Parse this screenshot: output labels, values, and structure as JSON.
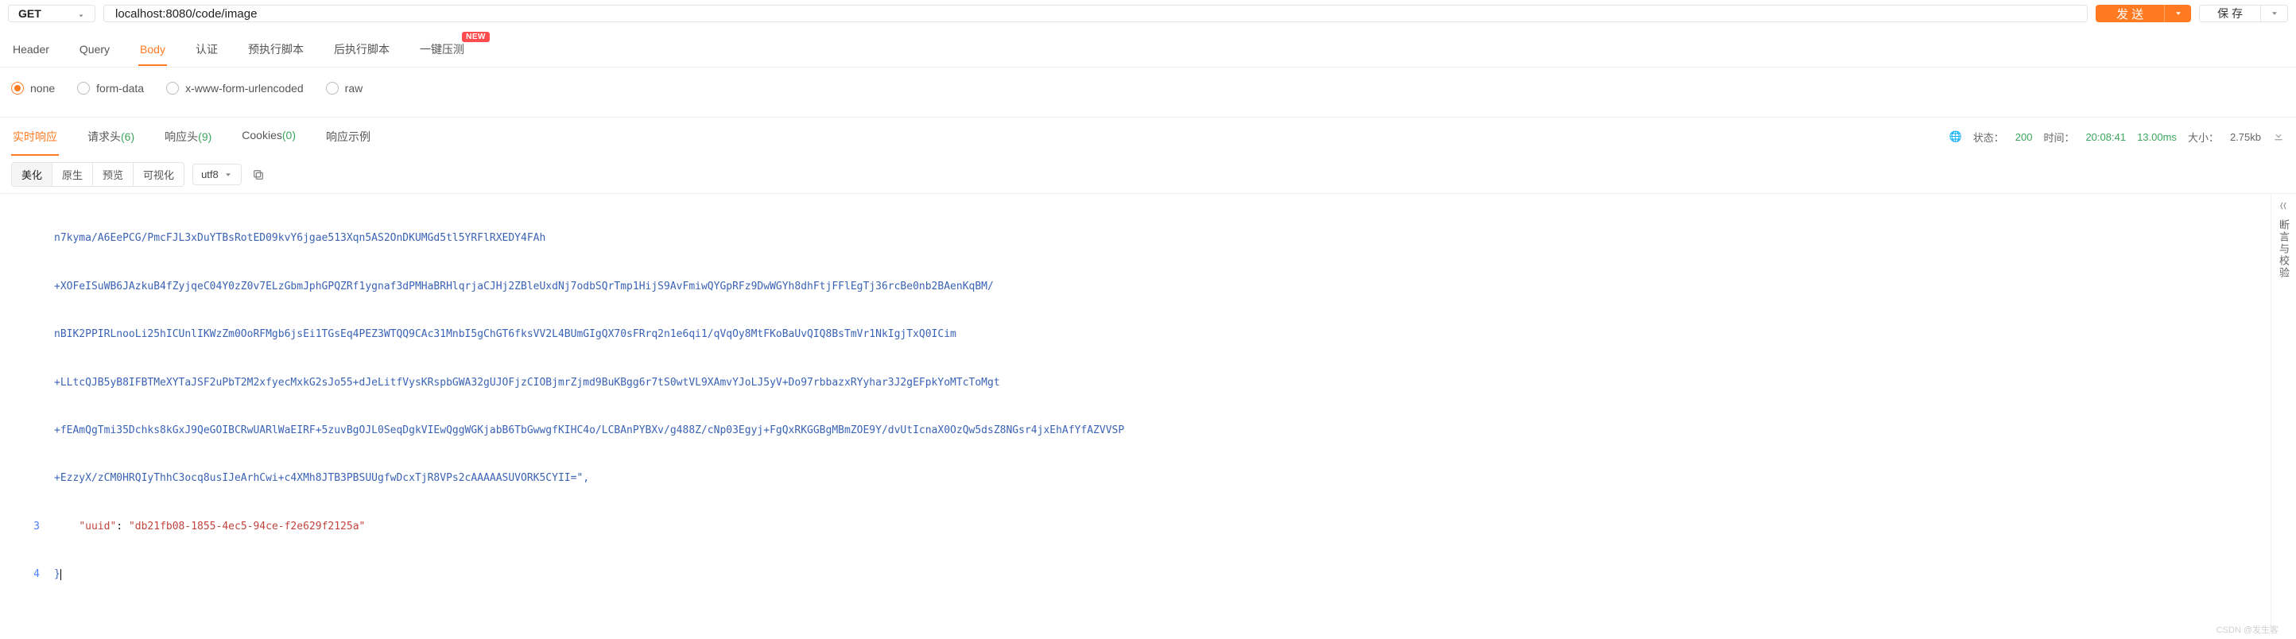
{
  "request": {
    "method": "GET",
    "url": "localhost:8080/code/image",
    "send_label": "发 送",
    "save_label": "保 存"
  },
  "request_tabs": {
    "items": [
      {
        "label": "Header"
      },
      {
        "label": "Query"
      },
      {
        "label": "Body",
        "active": true
      },
      {
        "label": "认证"
      },
      {
        "label": "预执行脚本"
      },
      {
        "label": "后执行脚本"
      },
      {
        "label": "一键压测",
        "badge": "NEW"
      }
    ]
  },
  "body_types": {
    "options": [
      {
        "label": "none",
        "checked": true
      },
      {
        "label": "form-data"
      },
      {
        "label": "x-www-form-urlencoded"
      },
      {
        "label": "raw"
      }
    ]
  },
  "response_tabs": {
    "items": [
      {
        "label": "实时响应",
        "active": true
      },
      {
        "label": "请求头",
        "count": 6
      },
      {
        "label": "响应头",
        "count": 9
      },
      {
        "label": "Cookies",
        "count": 0
      },
      {
        "label": "响应示例"
      }
    ]
  },
  "response_meta": {
    "status_label": "状态：",
    "status_code": "200",
    "time_label": "时间：",
    "time_value": "20:08:41",
    "duration": "13.00ms",
    "size_label": "大小：",
    "size_value": "2.75kb"
  },
  "response_toolbar": {
    "segs": [
      {
        "label": "美化",
        "active": true
      },
      {
        "label": "原生"
      },
      {
        "label": "预览"
      },
      {
        "label": "可视化"
      }
    ],
    "encoding": "utf8"
  },
  "editor": {
    "base64_lines": [
      "n7kyma/A6EePCG/PmcFJL3xDuYTBsRotED09kvY6jgae513Xqn5AS2OnDKUMGd5tl5YRFlRXEDY4FAh",
      "+XOFeISuWB6JAzkuB4fZyjqeC04Y0zZ0v7ELzGbmJphGPQZRf1ygnaf3dPMHaBRHlqrjaCJHj2ZBleUxdNj7odbSQrTmp1HijS9AvFmiwQYGpRFz9DwWGYh8dhFtjFFlEgTj36rcBe0nb2BAenKqBM/",
      "nBIK2PPIRLnooLi25hICUnlIKWzZm0OoRFMgb6jsEi1TGsEq4PEZ3WTQQ9CAc31MnbI5gChGT6fksVV2L4BUmGIgQX70sFRrq2n1e6qi1/qVqOy8MtFKoBaUvQIQ8BsTmVr1NkIgjTxQ0ICim",
      "+LLtcQJB5yB8IFBTMeXYTaJSF2uPbT2M2xfyecMxkG2sJo55+dJeLitfVysKRspbGWA32gUJOFjzCIOBjmrZjmd9BuKBgg6r7tS0wtVL9XAmvYJoLJ5yV+Do97rbbazxRYyhar3J2gEFpkYoMTcToMgt",
      "+fEAmQgTmi35Dchks8kGxJ9QeGOIBCRwUARlWaEIRF+5zuvBgOJL0SeqDgkVIEwQggWGKjabB6TbGwwgfKIHC4o/LCBAnPYBXv/g488Z/cNp03Egyj+FgQxRKGGBgMBmZOE9Y/dvUtIcnaX0OzQw5dsZ8NGsr4jxEhAfYfAZVVSP",
      "+EzzyX/zCM0HRQIyThhC3ocq8usIJeArhCwi+c4XMh8JTB3PBSUUgfwDcxTjR8VPs2cAAAAASUVORK5CYII=\","
    ],
    "uuid_key": "\"uuid\"",
    "uuid_value": "\"db21fb08-1855-4ec5-94ce-f2e629f2125a\"",
    "line_numbers": [
      "3",
      "4"
    ]
  },
  "sidebar": {
    "label": "断言与校验"
  },
  "watermark": "CSDN @发生客"
}
